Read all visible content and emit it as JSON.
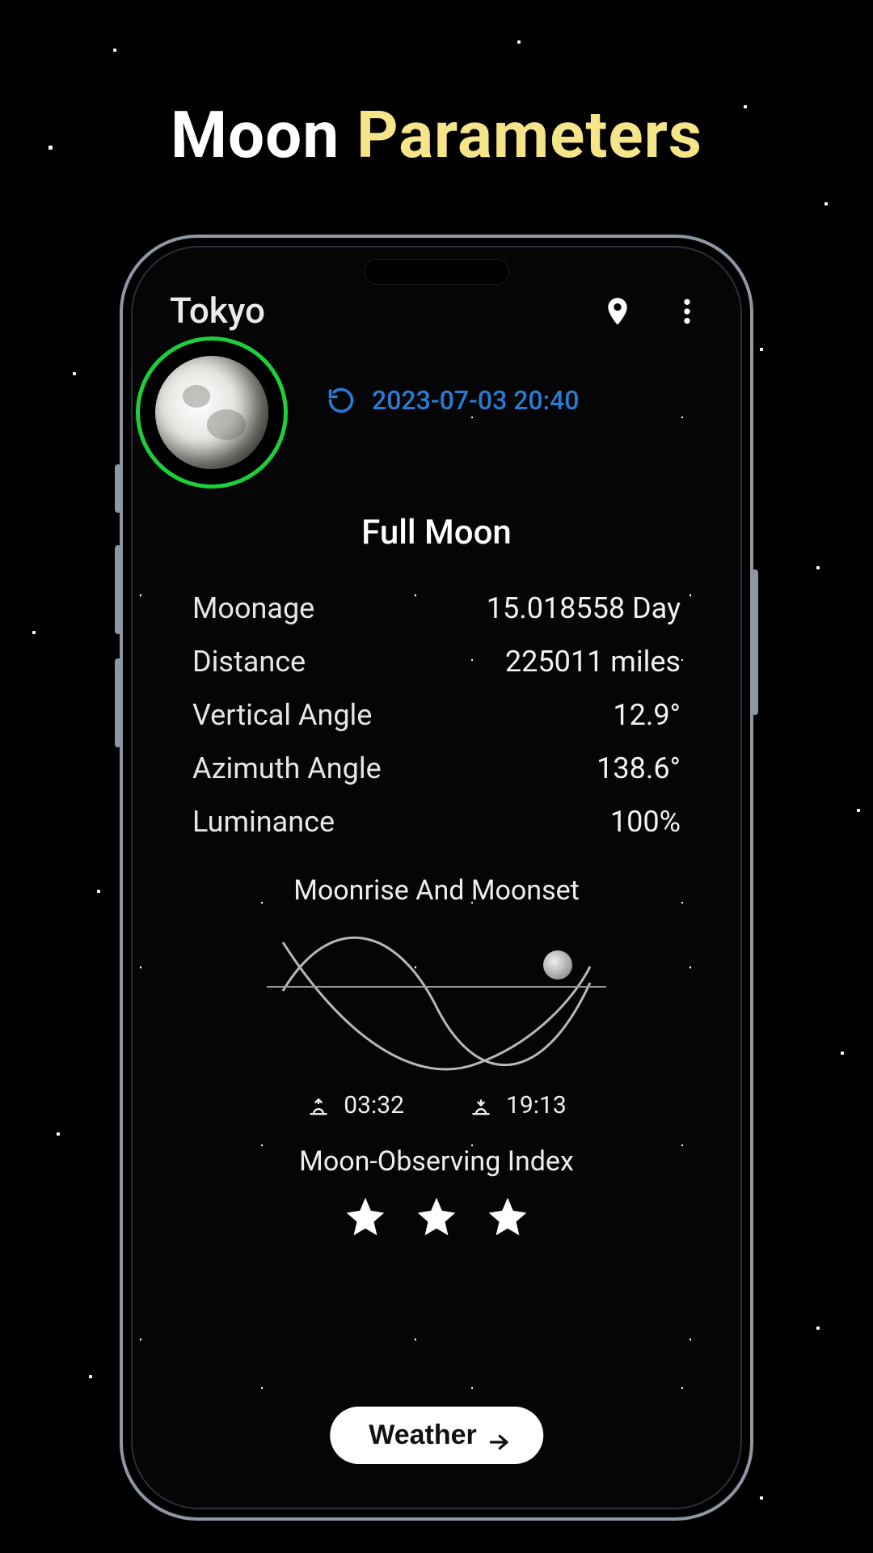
{
  "marketing": {
    "title_plain": "Moon",
    "title_accent": "Parameters"
  },
  "header": {
    "location": "Tokyo"
  },
  "datetime": "2023-07-03 20:40",
  "phase_name": "Full Moon",
  "params": {
    "moonage": {
      "label": "Moonage",
      "value": "15.018558 Day"
    },
    "distance": {
      "label": "Distance",
      "value": "225011 miles"
    },
    "vertical": {
      "label": "Vertical Angle",
      "value": "12.9°"
    },
    "azimuth": {
      "label": "Azimuth Angle",
      "value": "138.6°"
    },
    "luminance": {
      "label": "Luminance",
      "value": "100%"
    }
  },
  "rise_set": {
    "heading": "Moonrise And Moonset",
    "rise": "03:32",
    "set": "19:13"
  },
  "observing": {
    "heading": "Moon-Observing Index",
    "stars": 3
  },
  "weather_button": "Weather"
}
